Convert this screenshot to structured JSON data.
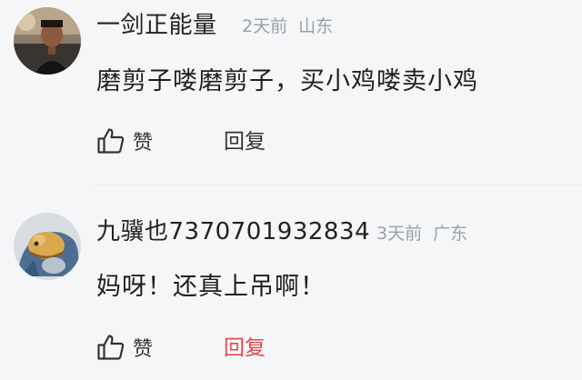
{
  "comments": [
    {
      "username": "一剑正能量",
      "time": "2天前",
      "location": "山东",
      "content": "磨剪子喽磨剪子，买小鸡喽卖小鸡",
      "like_label": "赞",
      "reply_label": "回复"
    },
    {
      "username": "九骥也7370701932834",
      "time": "3天前",
      "location": "广东",
      "content": "妈呀！还真上吊啊！",
      "like_label": "赞",
      "reply_label": "回复"
    }
  ],
  "icons": {
    "like": "thumbs-up-icon"
  },
  "colors": {
    "background": "#f5f6f8",
    "meta": "#9aa0a6",
    "reply_active": "#e5484d",
    "text": "#1f1f1f"
  }
}
